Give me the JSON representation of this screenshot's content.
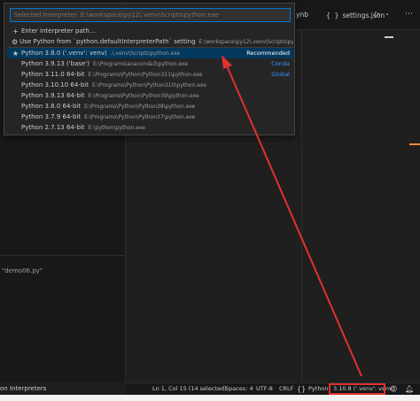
{
  "sidebar": {
    "hint_text": "\"demo06.py\"",
    "bottom_label": "on Interpreters"
  },
  "tabs": {
    "ipynb": "ynb",
    "settings": "settings.json",
    "settings_icon": "{ }"
  },
  "quickpick": {
    "placeholder": "Selected Interpreter: E:\\workspace\\py12\\.venv\\Scripts\\python.exe",
    "items": [
      {
        "icon": "plus-icon",
        "glyph": "+",
        "label": "Enter interpreter path...",
        "desc": "",
        "tag": ""
      },
      {
        "icon": "gear-icon",
        "glyph": "⚙",
        "label": "Use Python from `python.defaultInterpreterPath` setting",
        "desc": "E:\\workspace\\py12\\.venv\\Scripts\\pytho...",
        "tag": ""
      },
      {
        "icon": "star-icon",
        "glyph": "★",
        "label": "Python 3.8.0 ('.venv': venv)",
        "desc": ".\\.venv\\Scripts\\python.exe",
        "tag": "Recommended",
        "selected": true
      },
      {
        "icon": "",
        "glyph": "",
        "label": "Python 3.9.13 ('base')",
        "desc": "E:\\Programs\\anaconda3\\python.exe",
        "tag": "Conda"
      },
      {
        "icon": "",
        "glyph": "",
        "label": "Python 3.11.0 64-bit",
        "desc": "E:\\Programs\\Python\\Python311\\python.exe",
        "tag": "Global"
      },
      {
        "icon": "",
        "glyph": "",
        "label": "Python 3.10.10 64-bit",
        "desc": "E:\\Programs\\Python\\Python310\\python.exe",
        "tag": ""
      },
      {
        "icon": "",
        "glyph": "",
        "label": "Python 3.9.13 64-bit",
        "desc": "E:\\Programs\\Python\\Python39\\python.exe",
        "tag": ""
      },
      {
        "icon": "",
        "glyph": "",
        "label": "Python 3.8.0 64-bit",
        "desc": "E:\\Programs\\Python\\Python38\\python.exe",
        "tag": ""
      },
      {
        "icon": "",
        "glyph": "",
        "label": "Python 3.7.9 64-bit",
        "desc": "E:\\Programs\\Python\\Python37\\python.exe",
        "tag": ""
      },
      {
        "icon": "",
        "glyph": "",
        "label": "Python 2.7.13 64-bit",
        "desc": "E:\\python\\python.exe",
        "tag": ""
      }
    ]
  },
  "statusbar": {
    "position": "Ln 1, Col 15 (14 selected)",
    "spaces": "Spaces: 4",
    "encoding": "UTF-8",
    "eol": "CRLF",
    "language": "Python",
    "interpreter": "3.10.8 ('.venv': venv)"
  },
  "colors": {
    "accent": "#0078d4",
    "selection": "#04395e",
    "annotation": "#e03131",
    "tag": "#3794ff"
  }
}
